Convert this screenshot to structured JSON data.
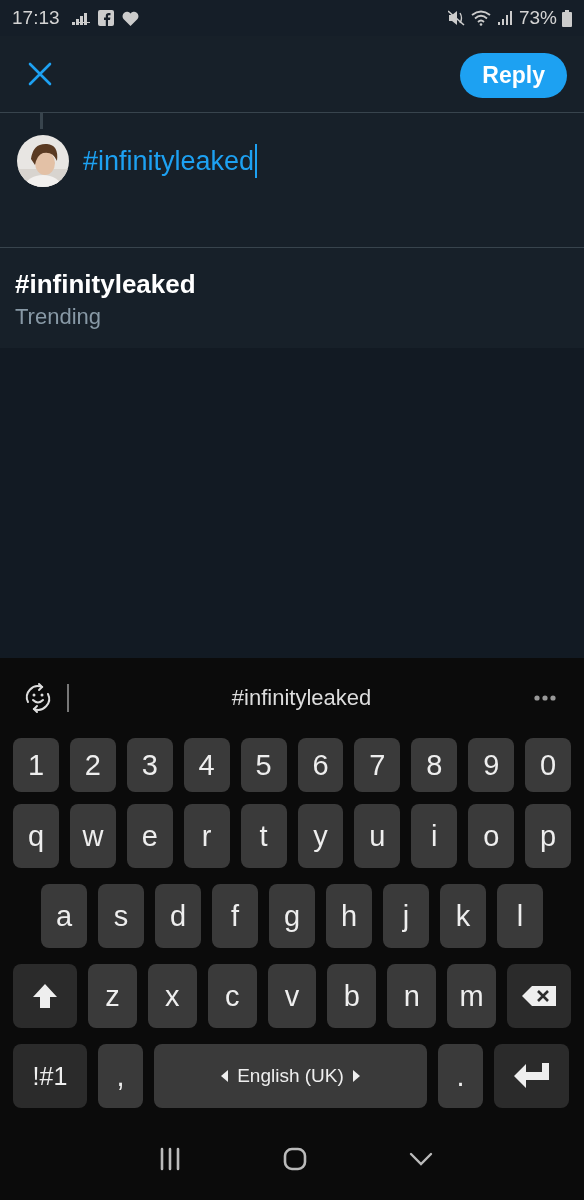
{
  "status_bar": {
    "time": "17:13",
    "battery": "73%"
  },
  "header": {
    "reply_button": "Reply"
  },
  "compose": {
    "value": "#infinityleaked"
  },
  "suggestions": [
    {
      "title": "#infinityleaked",
      "subtitle": "Trending"
    }
  ],
  "keyboard": {
    "prediction": "#infinityleaked",
    "rows": [
      {
        "keys": [
          {
            "kind": "char",
            "label": "1"
          },
          {
            "kind": "char",
            "label": "2"
          },
          {
            "kind": "char",
            "label": "3"
          },
          {
            "kind": "char",
            "label": "4"
          },
          {
            "kind": "char",
            "label": "5"
          },
          {
            "kind": "char",
            "label": "6"
          },
          {
            "kind": "char",
            "label": "7"
          },
          {
            "kind": "char",
            "label": "8"
          },
          {
            "kind": "char",
            "label": "9"
          },
          {
            "kind": "char",
            "label": "0"
          }
        ]
      },
      {
        "keys": [
          {
            "kind": "char",
            "label": "q"
          },
          {
            "kind": "char",
            "label": "w"
          },
          {
            "kind": "char",
            "label": "e"
          },
          {
            "kind": "char",
            "label": "r"
          },
          {
            "kind": "char",
            "label": "t"
          },
          {
            "kind": "char",
            "label": "y"
          },
          {
            "kind": "char",
            "label": "u"
          },
          {
            "kind": "char",
            "label": "i"
          },
          {
            "kind": "char",
            "label": "o"
          },
          {
            "kind": "char",
            "label": "p"
          }
        ]
      },
      {
        "keys": [
          {
            "kind": "char",
            "label": "a"
          },
          {
            "kind": "char",
            "label": "s"
          },
          {
            "kind": "char",
            "label": "d"
          },
          {
            "kind": "char",
            "label": "f"
          },
          {
            "kind": "char",
            "label": "g"
          },
          {
            "kind": "char",
            "label": "h"
          },
          {
            "kind": "char",
            "label": "j"
          },
          {
            "kind": "char",
            "label": "k"
          },
          {
            "kind": "char",
            "label": "l"
          }
        ]
      },
      {
        "keys": [
          {
            "kind": "shift"
          },
          {
            "kind": "char",
            "label": "z"
          },
          {
            "kind": "char",
            "label": "x"
          },
          {
            "kind": "char",
            "label": "c"
          },
          {
            "kind": "char",
            "label": "v"
          },
          {
            "kind": "char",
            "label": "b"
          },
          {
            "kind": "char",
            "label": "n"
          },
          {
            "kind": "char",
            "label": "m"
          },
          {
            "kind": "backspace"
          }
        ]
      },
      {
        "keys": [
          {
            "kind": "symbols",
            "label": "!#1"
          },
          {
            "kind": "punct",
            "label": ","
          },
          {
            "kind": "space",
            "label": "English (UK)"
          },
          {
            "kind": "punct",
            "label": "."
          },
          {
            "kind": "enter"
          }
        ]
      }
    ]
  }
}
